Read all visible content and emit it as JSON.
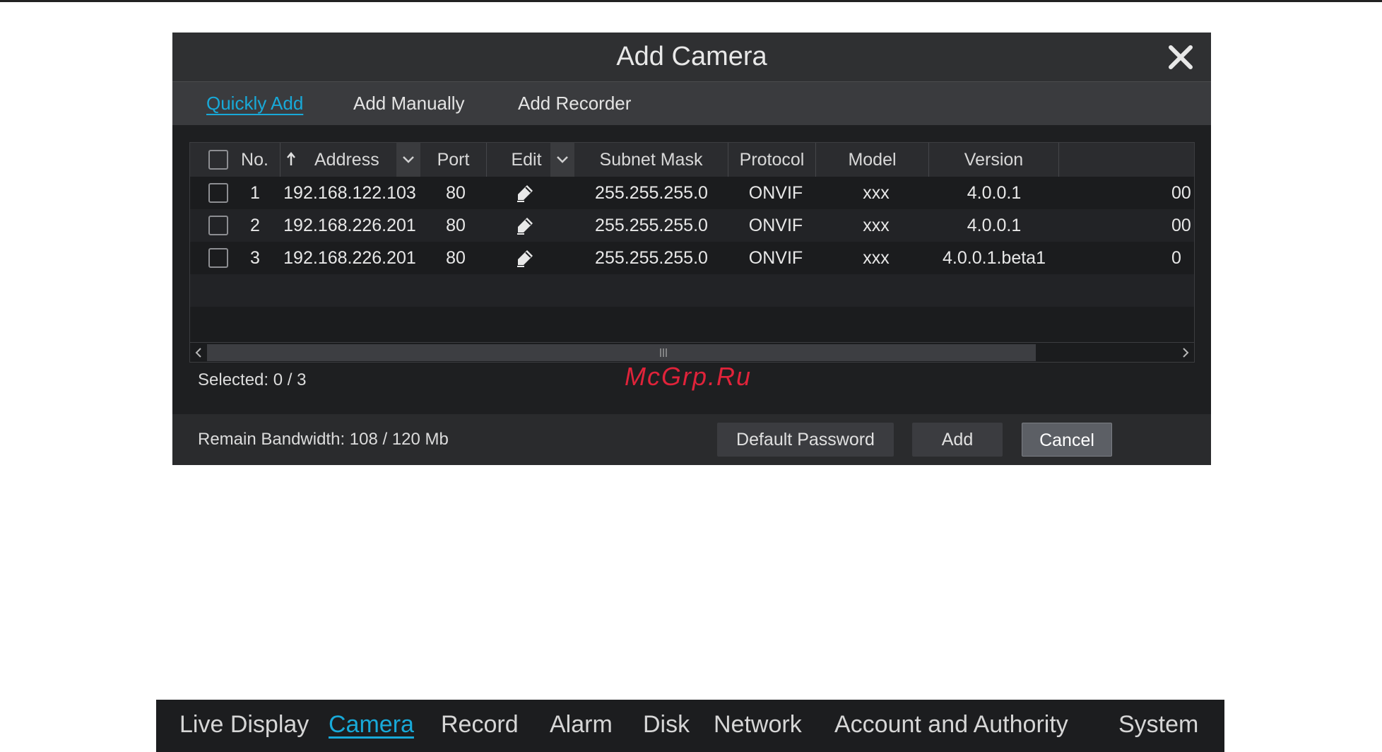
{
  "dialog": {
    "title": "Add Camera",
    "close_icon": "close-icon",
    "tabs": [
      {
        "label": "Quickly Add",
        "active": true
      },
      {
        "label": "Add Manually",
        "active": false
      },
      {
        "label": "Add Recorder",
        "active": false
      }
    ]
  },
  "table": {
    "headers": {
      "no": "No.",
      "address": "Address",
      "port": "Port",
      "edit": "Edit",
      "subnet_mask": "Subnet Mask",
      "protocol": "Protocol",
      "model": "Model",
      "version": "Version"
    },
    "rows": [
      {
        "no": "1",
        "address": "192.168.122.103",
        "port": "80",
        "subnet_mask": "255.255.255.0",
        "protocol": "ONVIF",
        "model": "xxx",
        "version": "4.0.0.1",
        "extra": "00"
      },
      {
        "no": "2",
        "address": "192.168.226.201",
        "port": "80",
        "subnet_mask": "255.255.255.0",
        "protocol": "ONVIF",
        "model": "xxx",
        "version": "4.0.0.1",
        "extra": "00"
      },
      {
        "no": "3",
        "address": "192.168.226.201",
        "port": "80",
        "subnet_mask": "255.255.255.0",
        "protocol": "ONVIF",
        "model": "xxx",
        "version": "4.0.0.1.beta1",
        "extra": "0"
      }
    ]
  },
  "selected": "Selected: 0 / 3",
  "watermark": "McGrp.Ru",
  "footer": {
    "bandwidth": "Remain Bandwidth: 108 / 120 Mb",
    "default_password": "Default Password",
    "add": "Add",
    "cancel": "Cancel"
  },
  "nav": [
    {
      "label": "Live Display",
      "active": false
    },
    {
      "label": "Camera",
      "active": true
    },
    {
      "label": "Record",
      "active": false
    },
    {
      "label": "Alarm",
      "active": false
    },
    {
      "label": "Disk",
      "active": false
    },
    {
      "label": "Network",
      "active": false
    },
    {
      "label": "Account and Authority",
      "active": false
    },
    {
      "label": "System",
      "active": false
    }
  ],
  "colors": {
    "accent": "#18a9d8",
    "dialog_bg": "#1e1f21",
    "watermark": "#e0233a"
  }
}
